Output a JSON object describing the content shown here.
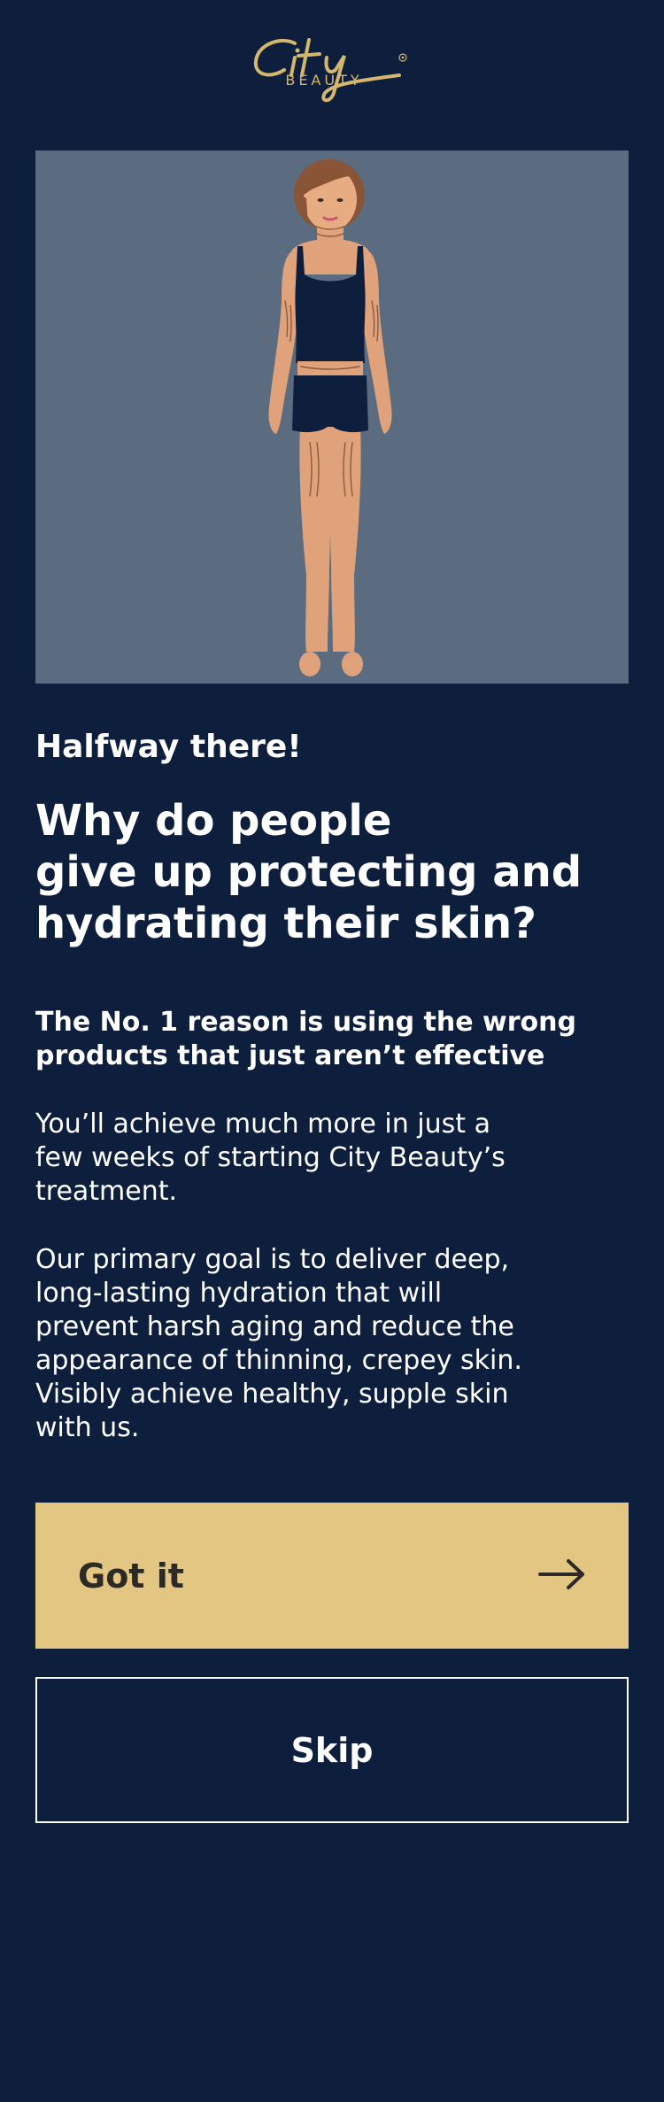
{
  "brand": {
    "logo_script": "City",
    "logo_sub": "BEAUTY",
    "logo_mark": "®",
    "color": "#d4b66e"
  },
  "hero": {
    "illustration": "woman-body-aging-illustration",
    "background": "#5b6b80"
  },
  "content": {
    "eyebrow": "Halfway there!",
    "headline": "Why do people\ngive up protecting and\nhydrating their skin?",
    "subhead": "The No. 1 reason is using the wrong\nproducts that just aren’t effective",
    "paragraph_1": "You’ll achieve much more in just a\nfew weeks of starting City Beauty’s\ntreatment.",
    "paragraph_2": "Our primary goal is to deliver deep,\nlong-lasting hydration that will\nprevent harsh aging and reduce the\nappearance of thinning, crepey skin.\nVisibly achieve healthy, supple skin\nwith us."
  },
  "actions": {
    "primary_label": "Got it",
    "primary_icon": "arrow-right-icon",
    "secondary_label": "Skip"
  },
  "colors": {
    "page_background": "#0d1f3c",
    "primary_button": "#e2c682",
    "text": "#ffffff"
  }
}
